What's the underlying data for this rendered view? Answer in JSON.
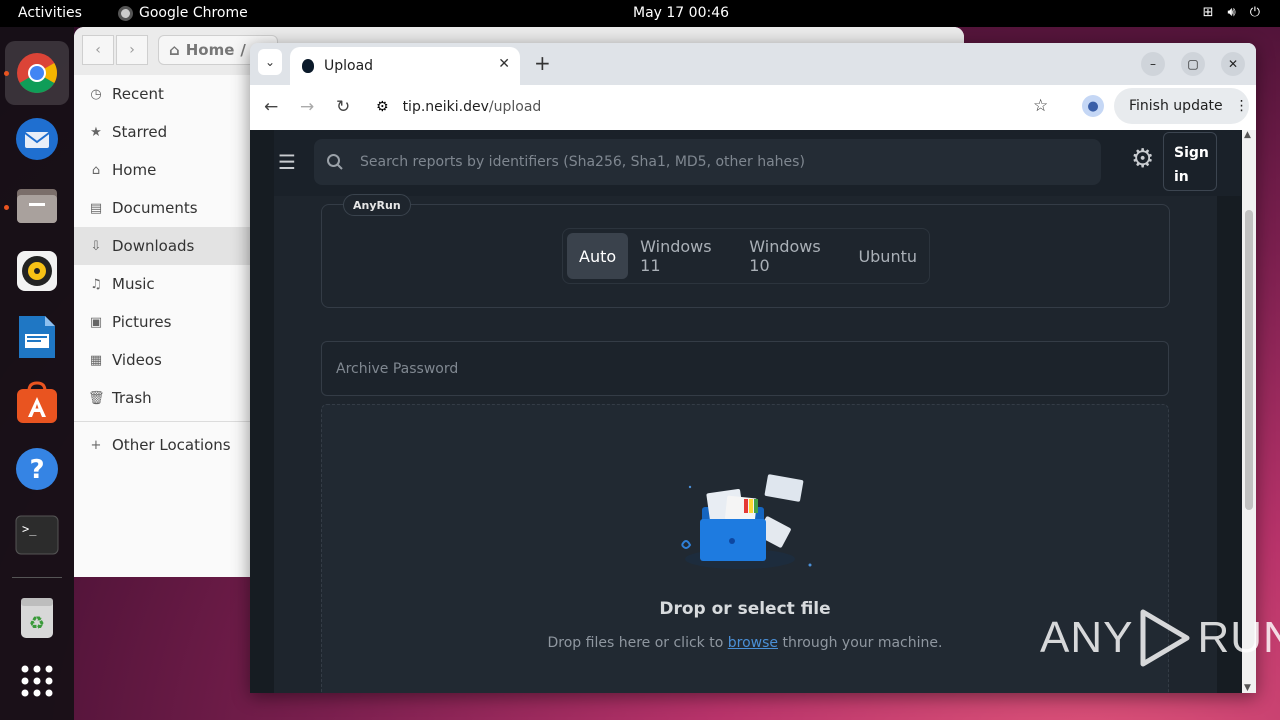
{
  "topbar": {
    "activities": "Activities",
    "app_name": "Google Chrome",
    "clock": "May 17  00:46",
    "tray_icons": [
      "network-icon",
      "volume-icon",
      "power-icon"
    ]
  },
  "dock": {
    "apps": [
      "chrome-icon",
      "thunderbird-icon",
      "files-icon",
      "rhythmbox-icon",
      "writer-icon",
      "app-center-icon",
      "help-icon",
      "terminal-icon",
      "trash-icon",
      "app-grid-icon"
    ]
  },
  "files": {
    "path_label": "Home",
    "sidebar": [
      {
        "label": "Recent",
        "icon": "clock-icon"
      },
      {
        "label": "Starred",
        "icon": "star-icon"
      },
      {
        "label": "Home",
        "icon": "home-icon"
      },
      {
        "label": "Documents",
        "icon": "document-icon"
      },
      {
        "label": "Downloads",
        "icon": "download-icon"
      },
      {
        "label": "Music",
        "icon": "music-icon"
      },
      {
        "label": "Pictures",
        "icon": "picture-icon"
      },
      {
        "label": "Videos",
        "icon": "video-icon"
      },
      {
        "label": "Trash",
        "icon": "trash-icon"
      }
    ],
    "other_locations": "Other Locations"
  },
  "browser": {
    "tab_title": "Upload",
    "url_host": "tip.neiki.dev",
    "url_path": "/upload",
    "update_label": "Finish update"
  },
  "page": {
    "search_placeholder": "Search reports by identifiers (Sha256, Sha1, MD5, other hahes)",
    "signin_label": "Sign in",
    "env_label": "AnyRun",
    "os_options": [
      "Auto",
      "Windows 11",
      "Windows 10",
      "Ubuntu"
    ],
    "os_selected": "Auto",
    "password_placeholder": "Archive Password",
    "drop_title": "Drop or select file",
    "drop_sub_prefix": "Drop files here or click to",
    "drop_sub_link": "browse",
    "drop_sub_suffix": "through your machine."
  },
  "watermark": {
    "left": "ANY",
    "right": "RUN"
  },
  "colors": {
    "ubuntu_orange": "#e95420",
    "page_bg": "#161c22",
    "link": "#4a8fd6"
  }
}
